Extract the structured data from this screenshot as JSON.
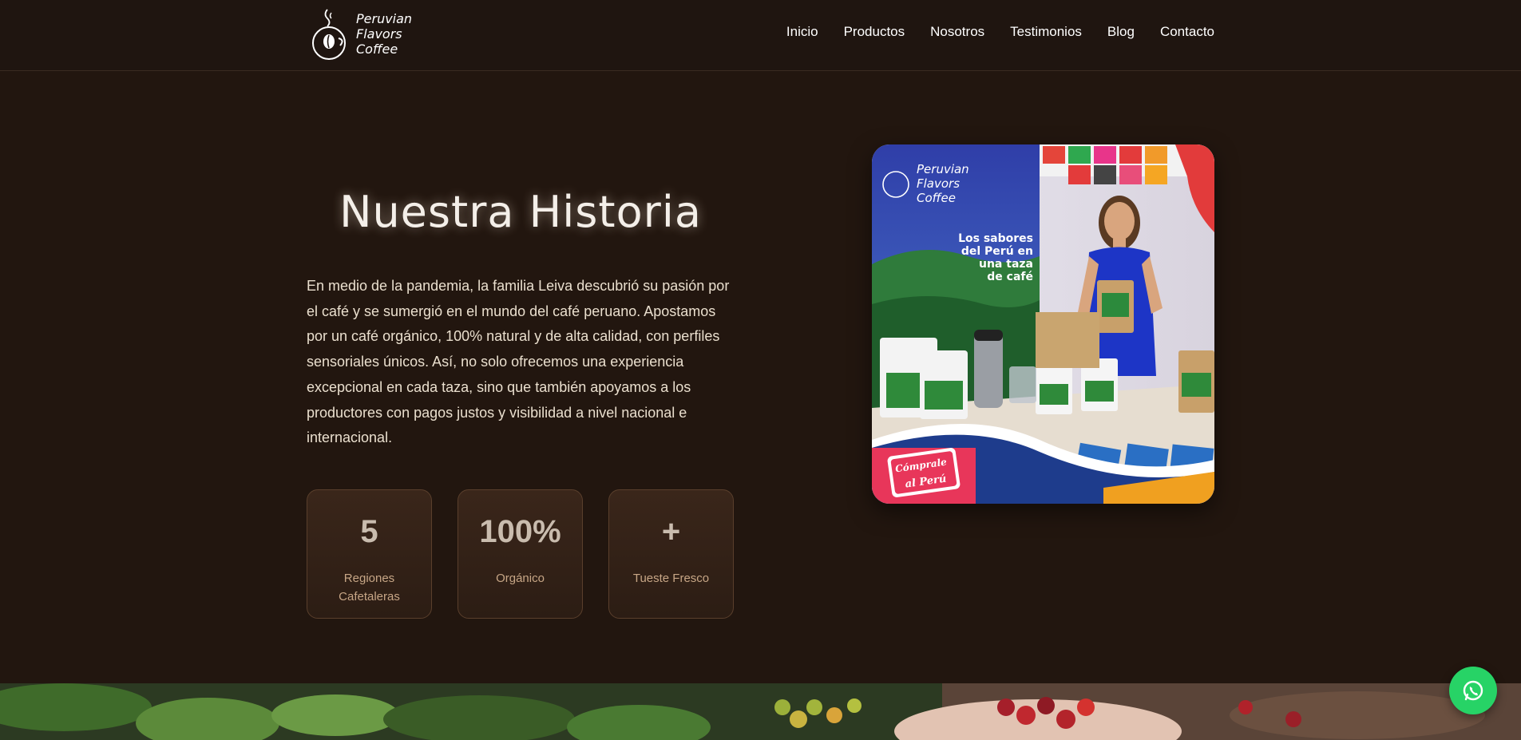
{
  "brand": {
    "name_line1": "Peruvian",
    "name_line2": "Flavors",
    "name_line3": "Coffee",
    "logo_icon": "coffee-cup-icon"
  },
  "nav": {
    "items": [
      {
        "label": "Inicio"
      },
      {
        "label": "Productos"
      },
      {
        "label": "Nosotros"
      },
      {
        "label": "Testimonios"
      },
      {
        "label": "Blog"
      },
      {
        "label": "Contacto"
      }
    ]
  },
  "about": {
    "title": "Nuestra Historia",
    "description": "En medio de la pandemia, la familia Leiva descubrió su pasión por el café y se sumergió en el mundo del café peruano. Apostamos por un café orgánico, 100% natural y de alta calidad, con perfiles sensoriales únicos. Así, no solo ofrecemos una experiencia excepcional en cada taza, sino que también apoyamos a los productores con pagos justos y visibilidad a nivel nacional e internacional.",
    "stats": [
      {
        "value": "5",
        "label": "Regiones Cafetaleras"
      },
      {
        "value": "100%",
        "label": "Orgánico"
      },
      {
        "value": "+",
        "label": "Tueste Fresco"
      }
    ]
  },
  "photo": {
    "banner_brand_line1": "Peruvian",
    "banner_brand_line2": "Flavors",
    "banner_brand_line3": "Coffee",
    "banner_line1": "Los sabores",
    "banner_line2": "del Perú en",
    "banner_line3": "una taza",
    "banner_line4": "de café",
    "badge_line1": "Cómprale",
    "badge_line2": "al Perú"
  },
  "floating": {
    "whatsapp_icon": "whatsapp-icon"
  },
  "colors": {
    "background": "#22160f",
    "header": "#1f1510",
    "accent_card_border": "#5a3f2c",
    "whatsapp": "#27d366"
  }
}
